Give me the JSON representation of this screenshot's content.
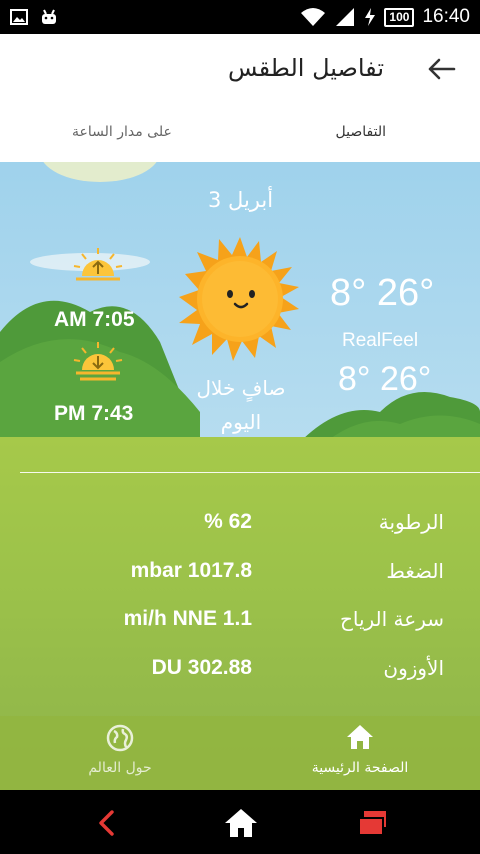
{
  "status_bar": {
    "time": "16:40",
    "battery": "100"
  },
  "header": {
    "title": "تفاصيل الطقس"
  },
  "tabs": [
    {
      "label": "التفاصيل",
      "active": true
    },
    {
      "label": "على مدار الساعة",
      "active": false
    }
  ],
  "weather": {
    "date": "3 أبريل",
    "temperature": "8° 26°",
    "realfeel_label": "RealFeel",
    "realfeel_temperature": "8° 26°",
    "condition": "صافٍ خلال اليوم",
    "sunrise": "AM 7:05",
    "sunset": "PM 7:43"
  },
  "details": [
    {
      "label": "الرطوبة",
      "value": "% 62"
    },
    {
      "label": "الضغط",
      "value": "mbar 1017.8"
    },
    {
      "label": "سرعة الرياح",
      "value": "mi/h NNE 1.1"
    },
    {
      "label": "الأوزون",
      "value": "DU 302.88"
    }
  ],
  "bottom_nav": {
    "home_label": "الصفحة الرئيسية",
    "world_label": "حول العالم"
  },
  "colors": {
    "accent_red": "#e53935",
    "grass": "#9cc24a",
    "sky": "#b9def0"
  }
}
